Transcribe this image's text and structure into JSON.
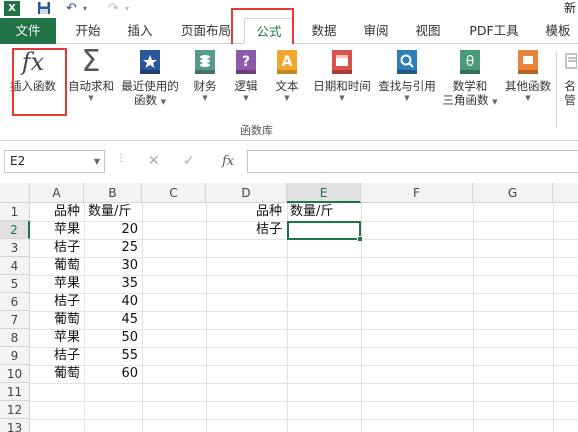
{
  "titlebar": {
    "app_icon": "X",
    "title": "新"
  },
  "tabs": {
    "file": "文件",
    "items": [
      "开始",
      "插入",
      "页面布局",
      "公式",
      "数据",
      "审阅",
      "视图",
      "PDF工具",
      "模板"
    ],
    "active": "公式"
  },
  "ribbon": {
    "buttons": [
      {
        "line1": "插入函数",
        "line2": "",
        "icon": "fx-icon"
      },
      {
        "line1": "自动求和",
        "line2": "",
        "icon": "sigma-icon"
      },
      {
        "line1": "最近使用的",
        "line2": "函数",
        "icon": "star-book-icon"
      },
      {
        "line1": "财务",
        "line2": "",
        "icon": "coins-book-icon"
      },
      {
        "line1": "逻辑",
        "line2": "",
        "icon": "question-book-icon"
      },
      {
        "line1": "文本",
        "line2": "",
        "icon": "text-book-icon"
      },
      {
        "line1": "日期和时间",
        "line2": "",
        "icon": "calendar-book-icon"
      },
      {
        "line1": "查找与引用",
        "line2": "",
        "icon": "search-book-icon"
      },
      {
        "line1": "数学和",
        "line2": "三角函数",
        "icon": "theta-book-icon"
      },
      {
        "line1": "其他函数",
        "line2": "",
        "icon": "more-book-icon"
      }
    ],
    "overflow_label_1": "名",
    "overflow_label_2": "管",
    "group_label": "函数库"
  },
  "formula_bar": {
    "name_box": "E2",
    "cancel": "✕",
    "enter": "✓",
    "fx": "fx",
    "value": ""
  },
  "sheet": {
    "columns": [
      "A",
      "B",
      "C",
      "D",
      "E",
      "F",
      "G"
    ],
    "rows": [
      "1",
      "2",
      "3",
      "4",
      "5",
      "6",
      "7",
      "8",
      "9",
      "10",
      "11",
      "12",
      "13"
    ],
    "active_cell": "E2",
    "table": {
      "header": [
        "品种",
        "数量/斤"
      ],
      "rows": [
        [
          "苹果",
          "20"
        ],
        [
          "桔子",
          "25"
        ],
        [
          "葡萄",
          "30"
        ],
        [
          "苹果",
          "35"
        ],
        [
          "桔子",
          "40"
        ],
        [
          "葡萄",
          "45"
        ],
        [
          "苹果",
          "50"
        ],
        [
          "桔子",
          "55"
        ],
        [
          "葡萄",
          "60"
        ]
      ]
    },
    "lookup": {
      "header_d": "品种",
      "header_e": "数量/斤",
      "value_d": "桔子"
    }
  },
  "colors": {
    "excel_green": "#217346",
    "highlight_red": "#e53935"
  }
}
